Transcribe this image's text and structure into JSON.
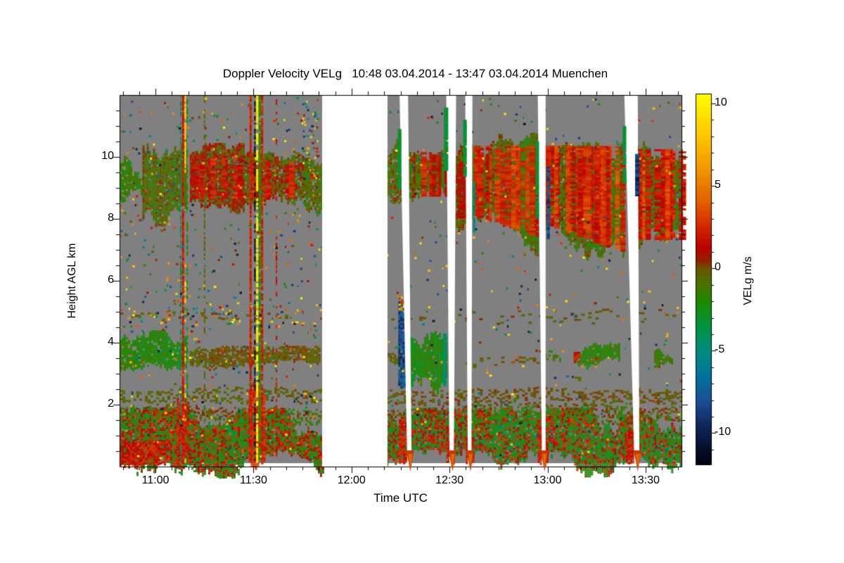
{
  "title": "Doppler Velocity VELg   10:48 03.04.2014 - 13:47 03.04.2014 Muenchen",
  "axes": {
    "x": {
      "label": "Time UTC",
      "start": "10:49",
      "end": "13:41",
      "major_tick_min": 30,
      "minor_tick_min": 5,
      "tick_labels": [
        "11:00",
        "11:30",
        "12:00",
        "12:30",
        "13:00",
        "13:30"
      ]
    },
    "y": {
      "label": "Height AGL km",
      "min": 0,
      "max": 12,
      "major_tick_km": 2,
      "minor_tick_km": 0.5,
      "tick_labels": [
        "2",
        "4",
        "6",
        "8",
        "10"
      ],
      "tick_values": [
        2,
        4,
        6,
        8,
        10
      ]
    }
  },
  "colorbar": {
    "label": "VELg m/s",
    "range": [
      -11.9,
      10.6
    ],
    "minor_tick_step": 1,
    "tick_values": [
      10,
      5,
      0,
      -5,
      -10
    ],
    "tick_labels": [
      "10",
      "5",
      "0",
      "-5",
      "-10"
    ]
  },
  "chart_data": {
    "type": "heatmap",
    "x_range": [
      "10:48",
      "13:47"
    ],
    "y_range_km": [
      0,
      12
    ],
    "value_units": "m/s",
    "no_signal_color": "#808080",
    "gap_color": "#ffffff",
    "colormap": [
      [
        10.6,
        "#ffff00"
      ],
      [
        8,
        "#ffc400"
      ],
      [
        6,
        "#f29500"
      ],
      [
        4,
        "#e25e00"
      ],
      [
        2.5,
        "#d32500"
      ],
      [
        1.3,
        "#bd0000"
      ],
      [
        0.5,
        "#941e00"
      ],
      [
        0,
        "#6d5400"
      ],
      [
        -0.8,
        "#4f7000"
      ],
      [
        -2,
        "#1d8a00"
      ],
      [
        -3.5,
        "#009540"
      ],
      [
        -5,
        "#008c80"
      ],
      [
        -6.5,
        "#00739b"
      ],
      [
        -8,
        "#1a4f97"
      ],
      [
        -9.5,
        "#10275c"
      ],
      [
        -11,
        "#050d28"
      ],
      [
        -11.9,
        "#01040f"
      ]
    ],
    "features": {
      "bands": [
        {
          "name": "cirrus-left-1",
          "t0": "10:49",
          "t1": "10:56",
          "h0": 8.55,
          "h1": 9.75,
          "v": -1.6,
          "spread": 1.0,
          "density": 0.85,
          "ragged": 0.45
        },
        {
          "name": "cirrus-left-2",
          "t0": "10:56",
          "t1": "11:09",
          "h0": 8.3,
          "h1": 10.15,
          "v": -0.7,
          "spread": 1.3,
          "density": 0.92,
          "ragged": 0.5
        },
        {
          "name": "cirrus-left-3",
          "t0": "11:10.5",
          "t1": "11:26.7",
          "h0": 8.55,
          "h1": 10.1,
          "v": 0.4,
          "spread": 1.5,
          "density": 0.95,
          "ragged": 0.35,
          "striations": {
            "n": 12,
            "v": 2.2,
            "spread": 0.9
          }
        },
        {
          "name": "cirrus-left-4",
          "t0": "11:26.7",
          "t1": "11:45.4",
          "h0": 8.55,
          "h1": 10.0,
          "v": -0.2,
          "spread": 1.4,
          "density": 0.92,
          "ragged": 0.35,
          "striations": {
            "n": 8,
            "v": 2.0,
            "spread": 0.8
          }
        },
        {
          "name": "cirrus-left-5",
          "t0": "11:45.4",
          "t1": "11:51",
          "h0": 8.5,
          "h1": 9.8,
          "v": -0.8,
          "spread": 1.2,
          "density": 0.88,
          "ragged": 0.4
        },
        {
          "name": "cloud-right-1",
          "t0": "12:09.8",
          "t1": "12:15",
          "h0": 8.9,
          "h1": 10.2,
          "v": -0.2,
          "spread": 1.4,
          "density": 0.9,
          "ragged": 0.4
        },
        {
          "name": "cloud-right-2",
          "t0": "12:17.7",
          "t1": "12:29.1",
          "h0": 8.6,
          "h1": 10.3,
          "v": -0.8,
          "spread": 1.4,
          "density": 0.95,
          "ragged": 0.4,
          "striations": {
            "n": 10,
            "v": 1.8,
            "spread": 1.0
          }
        },
        {
          "name": "cloud-right-3",
          "t0": "12:31.9",
          "t1": "12:34.5",
          "h0": 7.9,
          "h1": 10.0,
          "v": -0.3,
          "spread": 1.5,
          "density": 0.93,
          "ragged": 0.45,
          "striations": {
            "n": 5,
            "v": 2.0,
            "spread": 1.0
          }
        },
        {
          "name": "cloud-right-4",
          "t0": "12:36.6",
          "t1": "12:56.7",
          "h0": 8.0,
          "h0b": 7.3,
          "h1": 10.5,
          "v": -1.0,
          "spread": 1.4,
          "density": 0.97,
          "ragged": 0.5,
          "striations": {
            "n": 26,
            "v": 2.2,
            "spread": 1.2
          }
        },
        {
          "name": "cloud-right-5",
          "t0": "12:59",
          "t1": "13:23.1",
          "h0": 7.7,
          "h0b": 6.8,
          "h1": 10.5,
          "v": -0.6,
          "spread": 1.6,
          "density": 0.97,
          "ragged": 0.55,
          "striations": {
            "n": 34,
            "v": 2.4,
            "spread": 1.2
          }
        },
        {
          "name": "cloud-right-6",
          "t0": "13:27.2",
          "t1": "13:41",
          "h0": 7.2,
          "h1": 10.4,
          "v": -0.6,
          "spread": 1.6,
          "density": 0.95,
          "ragged": 0.5,
          "striations": {
            "n": 16,
            "v": 2.4,
            "spread": 1.2
          }
        },
        {
          "name": "aerosol-left",
          "t0": "10:49",
          "t1": "11:09.4",
          "h0": 3.05,
          "h1": 4.1,
          "v": -1.8,
          "spread": 0.9,
          "density": 0.92,
          "ragged": 0.3
        },
        {
          "name": "aerosol-left-thin",
          "t0": "11:10.5",
          "t1": "11:50.3",
          "h0": 3.3,
          "h1": 3.75,
          "v": -0.4,
          "spread": 0.6,
          "density": 0.85,
          "ragged": 0.15
        },
        {
          "name": "aerosol-mid",
          "t0": "12:09.8",
          "t1": "12:15",
          "h0": 3.3,
          "h1": 3.7,
          "v": -0.5,
          "spread": 0.6,
          "density": 0.5,
          "ragged": 0.15
        },
        {
          "name": "virga-blob",
          "t0": "12:17.7",
          "t1": "12:29.1",
          "h0": 2.6,
          "h1": 4.25,
          "v": -2.3,
          "spread": 1.1,
          "density": 0.96,
          "ragged": 0.5
        },
        {
          "name": "aerosol-row-1",
          "t0": "12:59",
          "t1": "13:04",
          "h0": 3.3,
          "h1": 3.65,
          "v": -0.6,
          "spread": 0.6,
          "density": 0.5,
          "ragged": 0.15
        },
        {
          "name": "aerosol-lens",
          "t0": "13:08",
          "t1": "13:22",
          "h0": 3.3,
          "h1": 3.75,
          "v": -1.5,
          "spread": 0.9,
          "density": 0.92,
          "ragged": 0.25
        },
        {
          "name": "aerosol-lens-tip",
          "t0": "13:08",
          "t1": "13:09.5",
          "h0": 3.4,
          "h1": 3.7,
          "v": 2.0,
          "spread": 1.0,
          "density": 0.9
        },
        {
          "name": "aerosol-patch",
          "t0": "13:32.6",
          "t1": "13:38",
          "h0": 3.3,
          "h1": 3.7,
          "v": -1.3,
          "spread": 0.8,
          "density": 0.85,
          "ragged": 0.2
        },
        {
          "name": "dash-row-35",
          "t0": "12:35",
          "t1": "12:57",
          "h0": 3.3,
          "h1": 3.6,
          "v": -0.3,
          "spread": 0.4,
          "density": 0.3,
          "cell": [
            5,
            3
          ]
        },
        {
          "name": "dash-row-28",
          "t0": "13:06",
          "t1": "13:12",
          "h0": 2.75,
          "h1": 2.95,
          "v": -0.3,
          "spread": 0.4,
          "density": 0.3,
          "cell": [
            5,
            3
          ]
        },
        {
          "name": "dash-row-5km-left",
          "t0": "10:49",
          "t1": "11:51",
          "h0": 4.7,
          "h1": 5.05,
          "v": -0.3,
          "spread": 0.5,
          "density": 0.12,
          "cell": [
            5,
            3
          ]
        },
        {
          "name": "dash-row-5km-right",
          "t0": "12:10",
          "t1": "13:41",
          "h0": 4.7,
          "h1": 5.05,
          "v": -0.3,
          "spread": 0.5,
          "density": 0.1,
          "cell": [
            5,
            3
          ]
        },
        {
          "name": "dash-band-2km-left",
          "t0": "10:49",
          "t1": "11:51",
          "h0": 2.05,
          "h1": 2.5,
          "v": -0.3,
          "spread": 0.5,
          "density": 0.4,
          "cell": [
            4,
            3
          ]
        },
        {
          "name": "dash-band-2km-right",
          "t0": "12:10",
          "t1": "13:41",
          "h0": 2.05,
          "h1": 2.5,
          "v": -0.3,
          "spread": 0.5,
          "density": 0.38,
          "cell": [
            4,
            3
          ]
        },
        {
          "name": "bl-fringe-left",
          "t0": "10:49",
          "t1": "11:51",
          "h0": 1.45,
          "h1": 1.95,
          "bimodal": [
            -1.3,
            0.3
          ],
          "spread": 0.8,
          "density": 0.5
        },
        {
          "name": "bl-fringe-right",
          "t0": "12:10",
          "t1": "13:41",
          "h0": 1.45,
          "h1": 1.95,
          "bimodal": [
            -1.3,
            0.3
          ],
          "spread": 0.8,
          "density": 0.45
        },
        {
          "name": "boundary-layer-left",
          "t0": "10:49",
          "t1": "11:51",
          "h0": 0.11,
          "h1": 1.45,
          "bimodal": [
            -2.2,
            2.0
          ],
          "spread": 1.3,
          "density": 0.97,
          "ragged": 0.45
        },
        {
          "name": "boundary-layer-right",
          "t0": "12:10",
          "t1": "13:41",
          "h0": 0.11,
          "h1": 1.45,
          "bimodal": [
            -2.2,
            1.8
          ],
          "spread": 1.3,
          "density": 0.97,
          "ragged": 0.45
        },
        {
          "name": "bl-red-left",
          "t0": "10:49",
          "t1": "11:04",
          "h0": 0.11,
          "h1": 0.85,
          "v": 2.0,
          "spread": 1.2,
          "density": 0.8
        },
        {
          "name": "red-plume-1108",
          "t0": "11:06.5",
          "t1": "11:10",
          "h0": 0.11,
          "h1": 2.3,
          "v": 2.3,
          "spread": 1.0,
          "density": 0.9,
          "ragged": 0.3
        },
        {
          "name": "red-plume-1130",
          "t0": "11:28.5",
          "t1": "11:33.5",
          "h0": 0.11,
          "h1": 2.6,
          "v": 2.4,
          "spread": 1.1,
          "density": 0.92,
          "ragged": 0.4
        },
        {
          "name": "bl-red-1216",
          "t0": "12:14.5",
          "t1": "12:17",
          "h0": 0.11,
          "h1": 1.6,
          "v": 2.2,
          "spread": 1.0,
          "density": 0.85
        },
        {
          "name": "bl-red-1230",
          "t0": "12:29",
          "t1": "12:31.5",
          "h0": 0.11,
          "h1": 1.3,
          "v": 2.2,
          "spread": 1.0,
          "density": 0.85
        },
        {
          "name": "bl-red-1236",
          "t0": "12:35",
          "t1": "12:37",
          "h0": 0.11,
          "h1": 1.0,
          "v": 2.0,
          "spread": 1.0,
          "density": 0.8
        },
        {
          "name": "bl-red-1258",
          "t0": "12:57",
          "t1": "13:00",
          "h0": 0.11,
          "h1": 1.3,
          "v": 2.2,
          "spread": 1.0,
          "density": 0.85
        },
        {
          "name": "bl-red-1325",
          "t0": "13:24",
          "t1": "13:27.5",
          "h0": 0.11,
          "h1": 1.2,
          "v": 2.2,
          "spread": 1.0,
          "density": 0.85
        },
        {
          "name": "downdraft-navy",
          "t0": "12:14.3",
          "t1": "12:16.9",
          "h0": 2.7,
          "h1": 5.2,
          "v": -8.5,
          "spread": 1.6,
          "density": 0.95,
          "ragged": 0.3
        },
        {
          "name": "downdraft-cap",
          "t0": "12:14.4",
          "t1": "12:16.5",
          "h0": 5.1,
          "h1": 5.5,
          "v": 5.0,
          "spread": 4.0,
          "density": 0.6
        }
      ],
      "streaks": [
        {
          "t": "11:07.5",
          "w": 2,
          "h0": 0.15,
          "h1": 12,
          "v": -4.5,
          "spread": 0.6,
          "dash": 0.5
        },
        {
          "t": "11:08.1",
          "w": 3,
          "h0": 0.15,
          "h1": 12,
          "v": 2.2,
          "spread": 0.6,
          "dash": 0.85
        },
        {
          "t": "11:08.9",
          "w": 2,
          "h0": 9.8,
          "h1": 12,
          "v": 9,
          "spread": 1,
          "dash": 0.8
        },
        {
          "t": "11:08.9",
          "w": 2,
          "h0": 0.15,
          "h1": 9.8,
          "v": 9,
          "spread": 1,
          "dash": 0.2
        },
        {
          "t": "11:09.5",
          "w": 2,
          "h0": 0.15,
          "h1": 12,
          "v": -2,
          "spread": 0.6,
          "dash": 0.4
        },
        {
          "t": "11:14.8",
          "w": 2,
          "h0": 0.15,
          "h1": 12,
          "v": -0.5,
          "spread": 0.5,
          "dash": 0.35
        },
        {
          "t": "11:28.8",
          "w": 3,
          "h0": 0.15,
          "h1": 12,
          "v": 2.3,
          "spread": 0.7,
          "dash": 0.9
        },
        {
          "t": "11:30.2",
          "w": 2,
          "h0": 0.15,
          "h1": 12,
          "v": -10.5,
          "spread": 1,
          "dash": 0.5
        },
        {
          "t": "11:30.8",
          "w": 3,
          "h0": 0.15,
          "h1": 12,
          "v": 9.5,
          "spread": 0.8,
          "dash": 0.7
        },
        {
          "t": "11:31.6",
          "w": 3,
          "h0": 0.15,
          "h1": 12,
          "v": -2.4,
          "spread": 0.7,
          "dash": 0.85
        },
        {
          "t": "11:32.3",
          "w": 3,
          "h0": 0.15,
          "h1": 12,
          "v": 2.2,
          "spread": 0.7,
          "dash": 0.8
        },
        {
          "t": "11:36.8",
          "w": 2,
          "h0": 0.15,
          "h1": 12,
          "v": 1.8,
          "spread": 1,
          "dash": 0.25
        }
      ],
      "slivers": [
        {
          "t": "12:28.0",
          "w": 5,
          "h0": 2.6,
          "h1": 4.3,
          "v": -4.5,
          "spread": 1,
          "dash": 0.95
        },
        {
          "t": "12:14.2",
          "w": 5,
          "h0": 9.0,
          "h1": 10.9,
          "v": -3.2,
          "spread": 0.8,
          "dash": 0.9
        },
        {
          "t": "12:28.3",
          "w": 6,
          "h0": 9.6,
          "h1": 11.6,
          "v": -3.4,
          "spread": 0.8,
          "dash": 0.9
        },
        {
          "t": "12:34.2",
          "w": 5,
          "h0": 9.4,
          "h1": 11.2,
          "v": -3.2,
          "spread": 0.8,
          "dash": 0.9
        },
        {
          "t": "12:56.3",
          "w": 5,
          "h0": 8.0,
          "h1": 10.5,
          "v": -3.0,
          "spread": 0.8,
          "dash": 0.9
        },
        {
          "t": "13:23.0",
          "w": 5,
          "h0": 9.2,
          "h1": 11.0,
          "v": -3.3,
          "spread": 0.8,
          "dash": 0.9
        },
        {
          "t": "12:59.8",
          "w": 4,
          "h0": 7.3,
          "h1": 9.7,
          "v": -8,
          "spread": 1.5,
          "dash": 0.95
        },
        {
          "t": "13:26.8",
          "w": 6,
          "h0": 8.8,
          "h1": 10.1,
          "v": -9,
          "spread": 1.5,
          "dash": 0.95
        },
        {
          "t": "12:37.2",
          "w": 3,
          "h0": 7.6,
          "h1": 9.2,
          "v": -5,
          "spread": 1,
          "dash": 0.9
        }
      ],
      "speckles": [
        {
          "t0": "10:49",
          "t1": "11:51",
          "h0": 0.3,
          "h1": 11.95,
          "n": 520
        },
        {
          "t0": "12:10",
          "t1": "13:41",
          "h0": 0.3,
          "h1": 11.95,
          "n": 420
        },
        {
          "t0": "11:44.9",
          "t1": "11:49.5",
          "h0": 9.3,
          "h1": 11.9,
          "n": 55,
          "vset": [
            -9,
            -5,
            2,
            8
          ]
        },
        {
          "t0": "10:49",
          "t1": "11:51",
          "h0": 4.5,
          "h1": 5.3,
          "n": 80
        }
      ],
      "gaps": [
        {
          "name": "gap-major",
          "top": [
            "11:51",
            "12:11"
          ],
          "bottom": [
            "11:51",
            "12:11"
          ]
        },
        {
          "name": "gap-1215",
          "top": [
            "12:14.7",
            "12:17.3"
          ],
          "bottom": [
            "12:17.1",
            "12:18.4"
          ]
        },
        {
          "name": "gap-1230",
          "top": [
            "12:29.0",
            "12:32.0"
          ],
          "bottom": [
            "12:30.0",
            "12:31.3"
          ]
        },
        {
          "name": "gap-1236",
          "top": [
            "12:34.8",
            "12:37.0"
          ],
          "bottom": [
            "12:35.6",
            "12:36.7"
          ]
        },
        {
          "name": "gap-1258",
          "top": [
            "12:57.0",
            "12:59.4"
          ],
          "bottom": [
            "12:58.3",
            "12:59.4"
          ]
        },
        {
          "name": "gap-1325",
          "top": [
            "13:23.5",
            "13:27.6"
          ],
          "bottom": [
            "13:26.6",
            "13:28.1"
          ]
        }
      ],
      "wedges": [
        "12:17.8",
        "12:30.7",
        "12:36.2",
        "12:58.9",
        "13:27.4"
      ]
    }
  }
}
